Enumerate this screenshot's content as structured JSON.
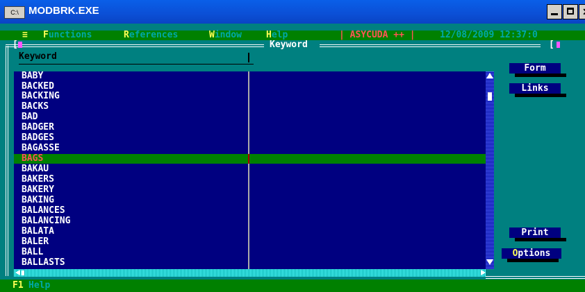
{
  "window": {
    "title": "MODBRK.EXE",
    "icon_text": "C:\\",
    "buttons": [
      "minimize",
      "maximize",
      "close"
    ],
    "close_glyph": "✕"
  },
  "menubar": {
    "system": "≡",
    "items": [
      {
        "hot": "F",
        "rest": "unctions"
      },
      {
        "hot": "R",
        "rest": "eferences"
      },
      {
        "hot": "W",
        "rest": "indow"
      },
      {
        "hot": "H",
        "rest": "elp"
      }
    ],
    "app_segment": "| ASYCUDA ++ |",
    "datetime": "12/08/2009 12:37:0"
  },
  "panel": {
    "title": "Keyword",
    "left_marker": "[",
    "right_marker": "[",
    "column_header": "Keyword"
  },
  "keywords": [
    "BABY",
    "BACKED",
    "BACKING",
    "BACKS",
    "BAD",
    "BADGER",
    "BADGES",
    "BAGASSE",
    "BAGS",
    "BAKAU",
    "BAKERS",
    "BAKERY",
    "BAKING",
    "BALANCES",
    "BALANCING",
    "BALATA",
    "BALER",
    "BALL",
    "BALLASTS"
  ],
  "selected_keyword": "BAGS",
  "side_buttons": {
    "form": "Form",
    "links": "Links",
    "print": "Print",
    "options": {
      "hot": "O",
      "rest": "ptions"
    }
  },
  "helpbar": {
    "key": "F1",
    "label": "Help"
  },
  "colors": {
    "console_bg": "#008080",
    "list_bg": "#000080",
    "menu_bg": "#008000",
    "highlight": "#ffff55",
    "selected_text": "#ff5555"
  }
}
